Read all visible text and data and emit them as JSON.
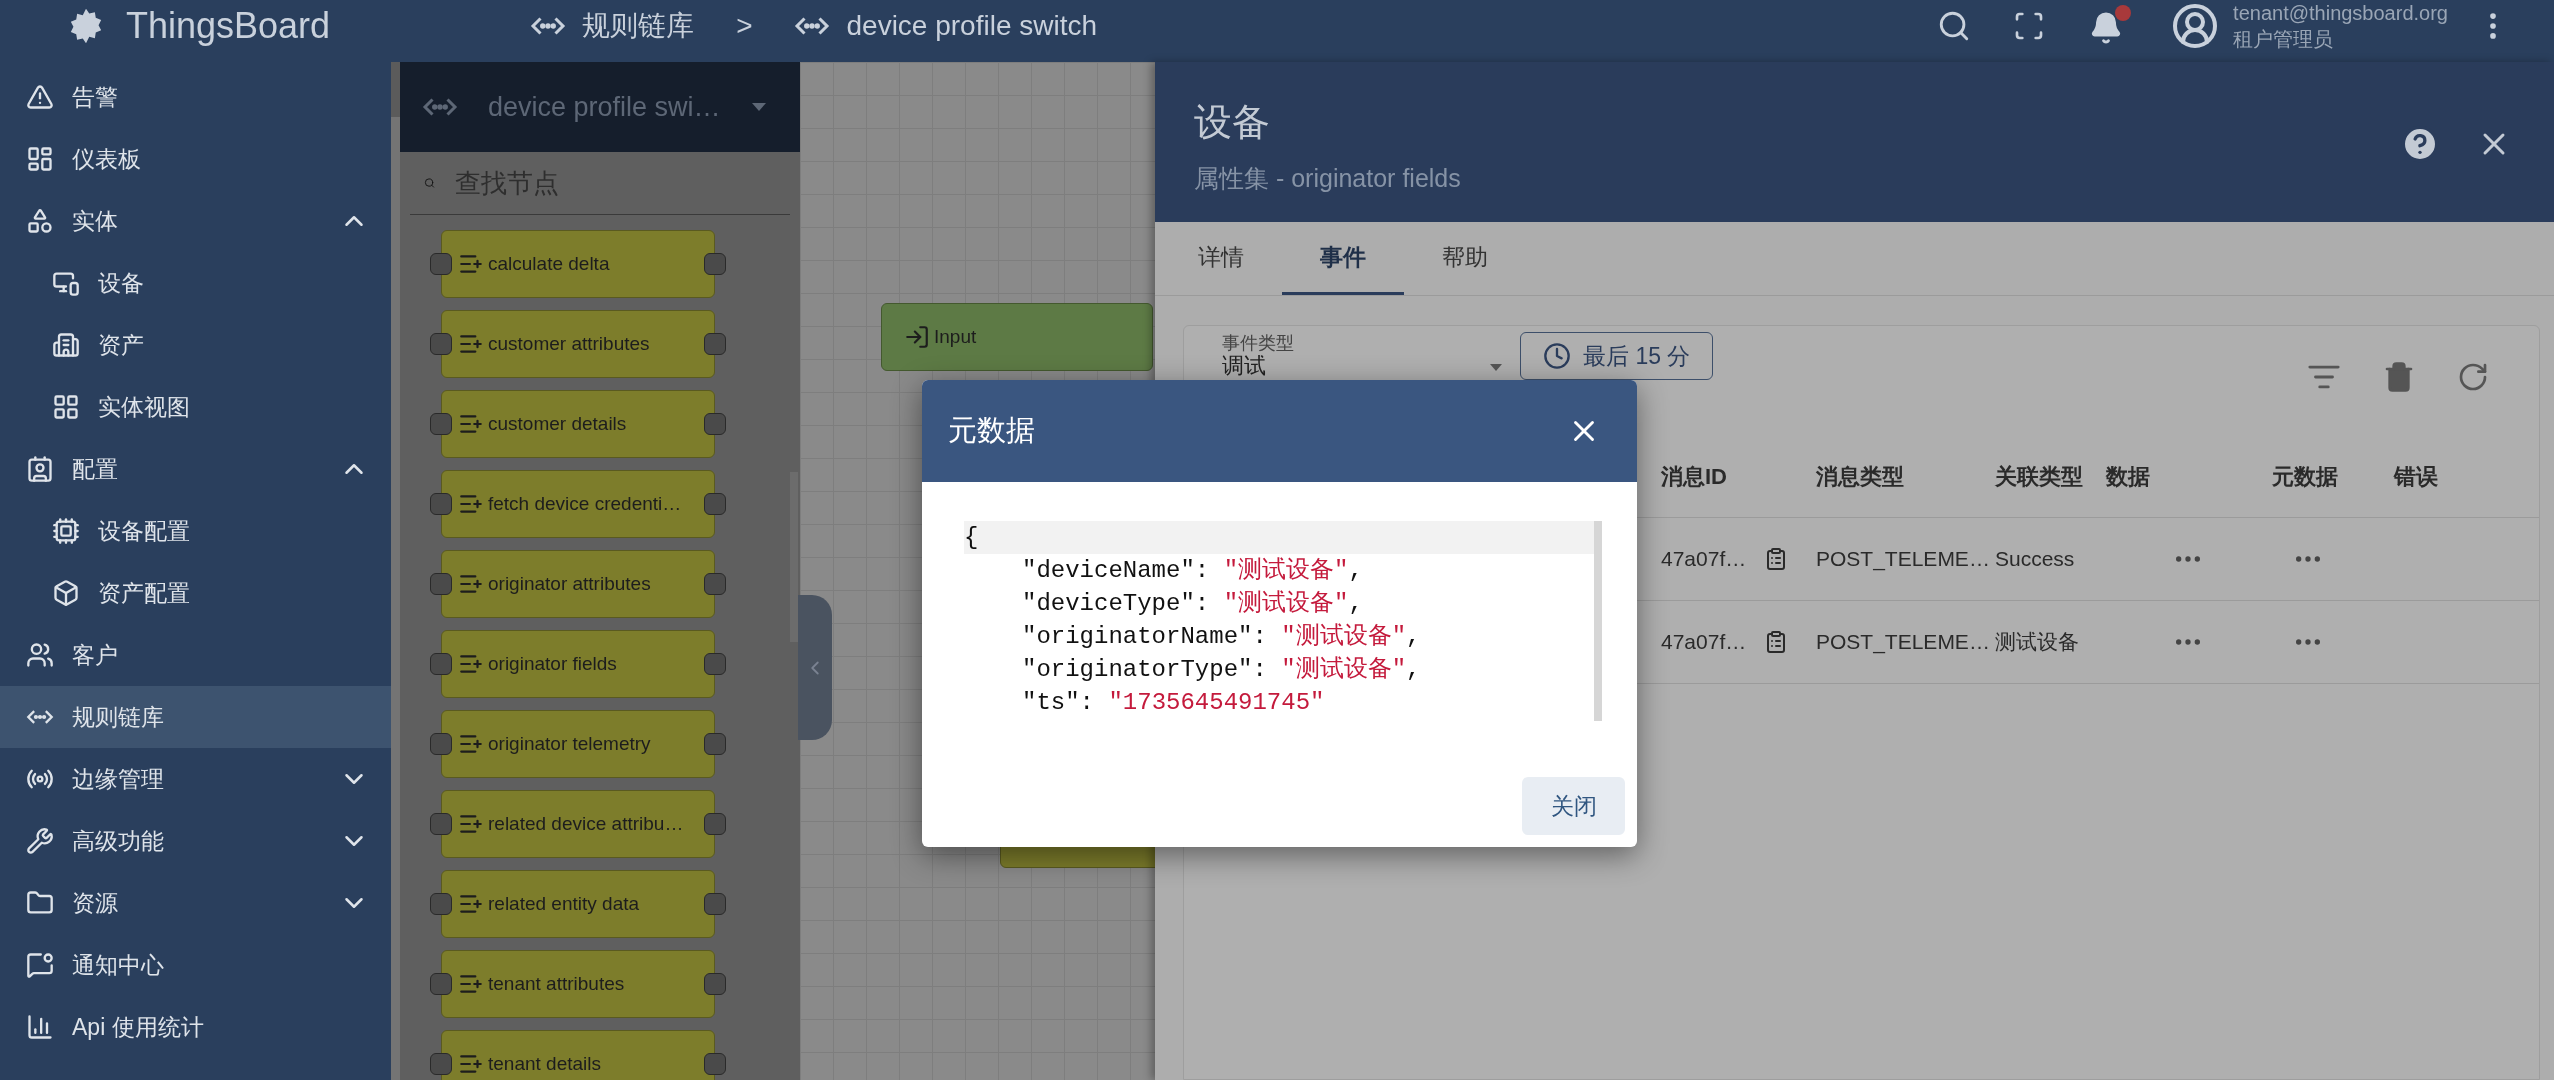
{
  "header": {
    "logo": "ThingsBoard",
    "breadcrumbs": [
      {
        "label": "规则链库"
      },
      {
        "label": "device profile switch"
      }
    ],
    "separator": ">",
    "user": {
      "email": "tenant@thingsboard.org",
      "role": "租户管理员"
    }
  },
  "sidebar": {
    "items": [
      {
        "label": "告警",
        "selected": false
      },
      {
        "label": "仪表板",
        "selected": false
      },
      {
        "label": "实体",
        "selected": false,
        "expanded": true,
        "children": [
          {
            "label": "设备",
            "selected": false
          },
          {
            "label": "资产",
            "selected": false
          },
          {
            "label": "实体视图",
            "selected": false
          }
        ]
      },
      {
        "label": "配置",
        "selected": false,
        "expanded": true,
        "children": [
          {
            "label": "设备配置",
            "selected": false
          },
          {
            "label": "资产配置",
            "selected": false
          }
        ]
      },
      {
        "label": "客户",
        "selected": false
      },
      {
        "label": "规则链库",
        "selected": true
      },
      {
        "label": "边缘管理",
        "selected": false,
        "expanded": false
      },
      {
        "label": "高级功能",
        "selected": false,
        "expanded": false
      },
      {
        "label": "资源",
        "selected": false,
        "expanded": false
      },
      {
        "label": "通知中心",
        "selected": false
      },
      {
        "label": "Api 使用统计",
        "selected": false
      }
    ]
  },
  "node_library": {
    "chain": "device profile swi…",
    "search": {
      "placeholder": "查找节点"
    },
    "nodes": [
      "calculate delta",
      "customer attributes",
      "customer details",
      "fetch device credenti…",
      "originator attributes",
      "originator fields",
      "originator telemetry",
      "related device attribu…",
      "related entity data",
      "tenant attributes",
      "tenant details"
    ]
  },
  "canvas": {
    "nodes": [
      {
        "kind": "input",
        "label": "Input"
      },
      {
        "kind": "enrichment"
      }
    ]
  },
  "details": {
    "title": "设备",
    "subtitle": "属性集 - originator fields",
    "tabs": [
      {
        "label": "详情",
        "selected": false
      },
      {
        "label": "事件",
        "selected": true
      },
      {
        "label": "帮助",
        "selected": false
      }
    ],
    "event_type": {
      "label": "事件类型",
      "value": "调试"
    },
    "time_button": "最后 15 分",
    "table": {
      "columns": [
        "消息ID",
        "消息类型",
        "关联类型",
        "数据",
        "元数据",
        "错误"
      ],
      "rows": [
        {
          "message_id": "47a07f…",
          "message_type": "POST_TELEME…",
          "relation_type": "Success"
        },
        {
          "message_id": "47a07f…",
          "message_type": "POST_TELEME…",
          "relation_type": "测试设备"
        }
      ]
    }
  },
  "dialog": {
    "title": "元数据",
    "code": {
      "open": "{",
      "lines": [
        {
          "key": "\"deviceName\": ",
          "value": "\"测试设备\"",
          "tail": ","
        },
        {
          "key": "\"deviceType\": ",
          "value": "\"测试设备\"",
          "tail": ","
        },
        {
          "key": "\"originatorName\": ",
          "value": "\"测试设备\"",
          "tail": ","
        },
        {
          "key": "\"originatorType\": ",
          "value": "\"测试设备\"",
          "tail": ","
        },
        {
          "key": "\"ts\": ",
          "value": "\"1735645491745\""
        }
      ]
    },
    "close_button": "关闭"
  }
}
